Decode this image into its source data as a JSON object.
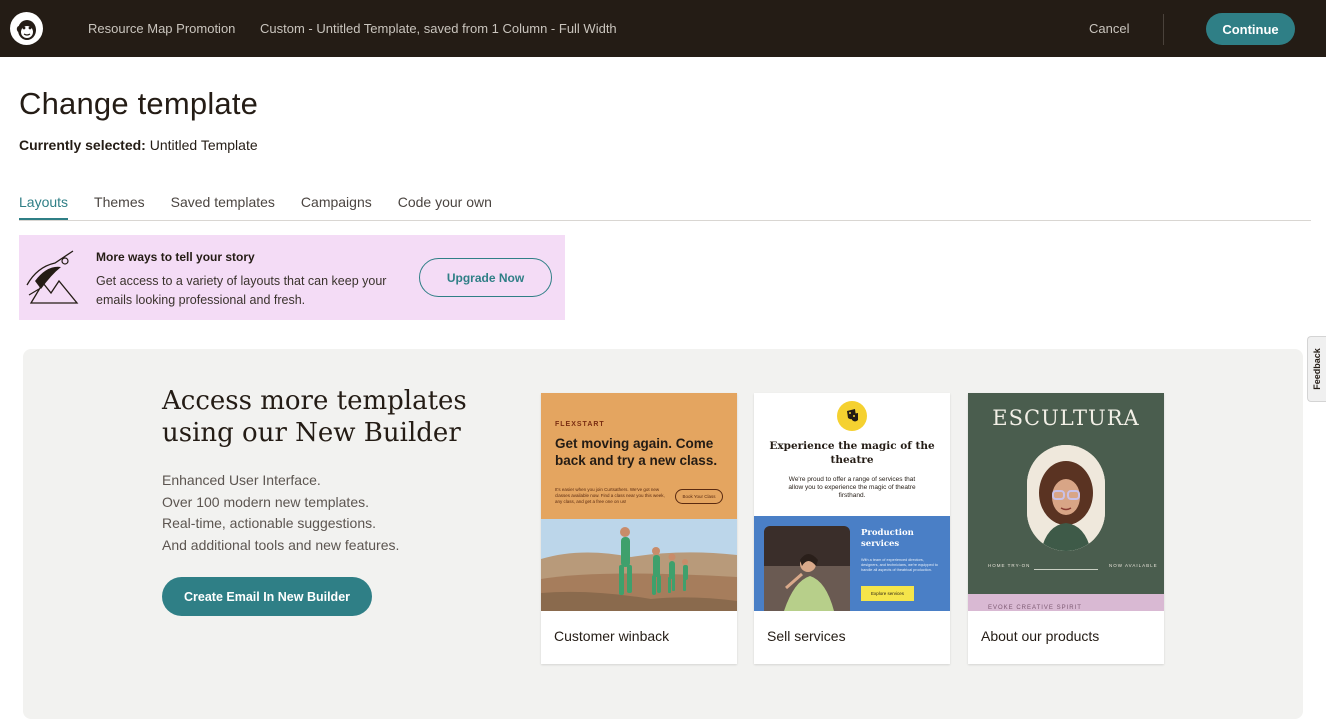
{
  "topbar": {
    "breadcrumb_campaign": "Resource Map Promotion",
    "breadcrumb_template": "Custom - Untitled Template, saved from 1 Column - Full Width",
    "cancel_label": "Cancel",
    "continue_label": "Continue",
    "logo_icon": "mailchimp-logo-icon"
  },
  "header": {
    "title": "Change template",
    "current_label": "Currently selected:",
    "current_value": "Untitled Template"
  },
  "tabs": [
    {
      "label": "Layouts",
      "active": true
    },
    {
      "label": "Themes",
      "active": false
    },
    {
      "label": "Saved templates",
      "active": false
    },
    {
      "label": "Campaigns",
      "active": false
    },
    {
      "label": "Code your own",
      "active": false
    }
  ],
  "banner": {
    "title": "More ways to tell your story",
    "body": "Get access to a variety of layouts that can keep your emails looking professional and fresh.",
    "button_label": "Upgrade Now"
  },
  "feedback_label": "Feedback",
  "promo": {
    "heading": "Access more templates using our New Builder",
    "features": [
      "Enhanced User Interface.",
      "Over 100 modern new templates.",
      "Real-time, actionable suggestions.",
      "And additional tools and new features."
    ],
    "button_label": "Create Email In New Builder"
  },
  "cards": [
    {
      "label": "Customer winback",
      "preview": {
        "brand": "FLEXSTART",
        "headline": "Get moving again. Come back and try a new class.",
        "body": "It's easier when you join Curtsathers. We've got new classes available now. Find a class near you this week, any class, and get a free one on us!",
        "button": "Book Your Class"
      }
    },
    {
      "label": "Sell services",
      "preview": {
        "headline": "Experience the magic of the theatre",
        "body": "We're proud to offer a range of services that allow you to experience the magic of theatre firsthand.",
        "section_title": "Production services",
        "section_body": "With a team of experienced directors, designers, and technicians, we're equipped to handle all aspects of theatrical production.",
        "section_button": "Explore services"
      }
    },
    {
      "label": "About our products",
      "preview": {
        "brand": "ESCULTURA",
        "left_caption": "HOME TRY-ON",
        "right_caption": "NOW AVAILABLE",
        "footer_text": "EVOKE  CREATIVE SPIRIT"
      }
    }
  ],
  "colors": {
    "topbar_bg": "#241c15",
    "accent": "#2f7f86",
    "banner_bg": "#f4dcf6",
    "panel_bg": "#f2f2f0"
  }
}
